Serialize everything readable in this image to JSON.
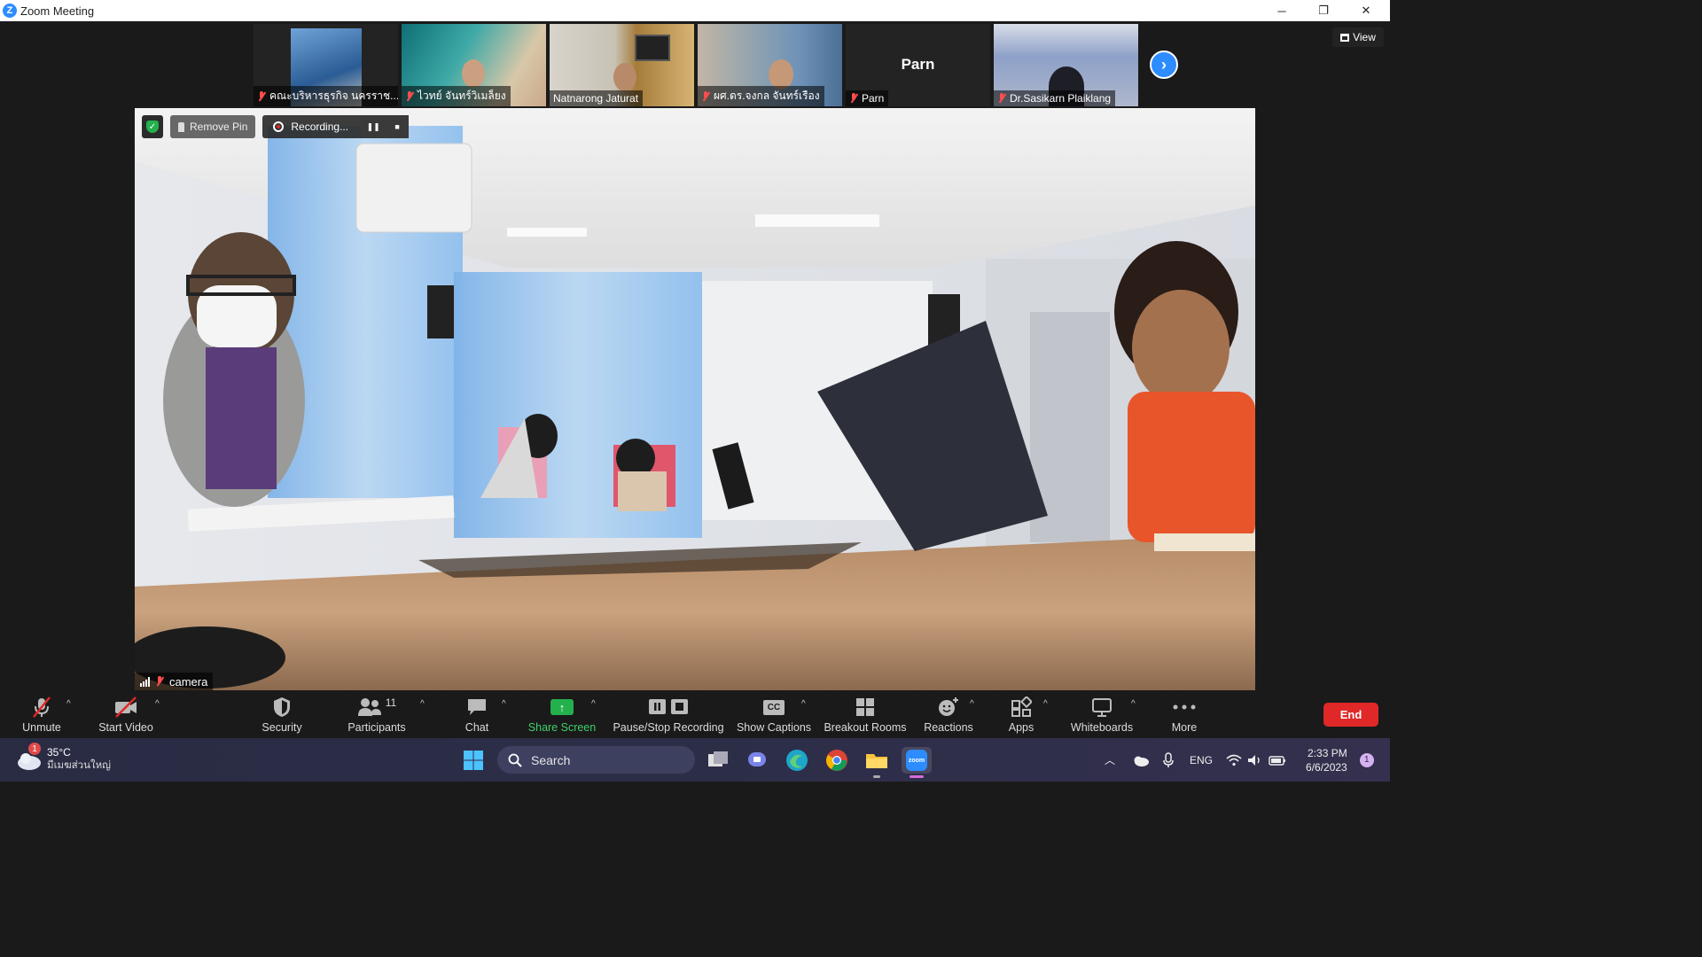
{
  "window": {
    "title": "Zoom Meeting",
    "minimize": "─",
    "restore": "❐",
    "close": "✕"
  },
  "gallery": {
    "participants": [
      {
        "name": "คณะบริหารธุรกิจ นครราช...",
        "muted": true,
        "bg": "#3b5a8a"
      },
      {
        "name": "ไวทย์ จันทร์วิเมล็ยง",
        "muted": true,
        "bg": "#3f8f95"
      },
      {
        "name": "Natnarong Jaturat",
        "muted": false,
        "bg": "#7a6a4a"
      },
      {
        "name": "ผศ.ดร.จงกล  จันทร์เรือง",
        "muted": true,
        "bg": "#5c7080"
      },
      {
        "name": "Parn",
        "muted": true,
        "bg": "#232323",
        "center_name": "Parn"
      },
      {
        "name": "Dr.Sasikarn Plaiklang",
        "muted": true,
        "bg": "#6e7890"
      }
    ],
    "next_icon": "chevron-right-icon",
    "view_label": "View"
  },
  "overlay": {
    "remove_pin": "Remove Pin",
    "recording": "Recording...",
    "pause_symbol": "❚❚",
    "stop_symbol": "■",
    "shield_symbol": "✓"
  },
  "active_speaker": {
    "name": "camera"
  },
  "toolbar": {
    "unmute": "Unmute",
    "start_video": "Start Video",
    "security": "Security",
    "participants": "Participants",
    "participants_count": "11",
    "chat": "Chat",
    "share_screen": "Share Screen",
    "pause_stop_recording": "Pause/Stop Recording",
    "show_captions": "Show Captions",
    "captions_symbol": "CC",
    "breakout_rooms": "Breakout Rooms",
    "reactions": "Reactions",
    "apps": "Apps",
    "whiteboards": "Whiteboards",
    "more": "More",
    "end": "End",
    "caret": "^"
  },
  "taskbar": {
    "weather_temp": "35°C",
    "weather_desc": "มีเมฆส่วนใหญ่",
    "weather_badge": "1",
    "search_label": "Search",
    "language": "ENG",
    "time": "2:33 PM",
    "date": "6/6/2023",
    "notification_count": "1",
    "zoom_label": "zoom"
  }
}
